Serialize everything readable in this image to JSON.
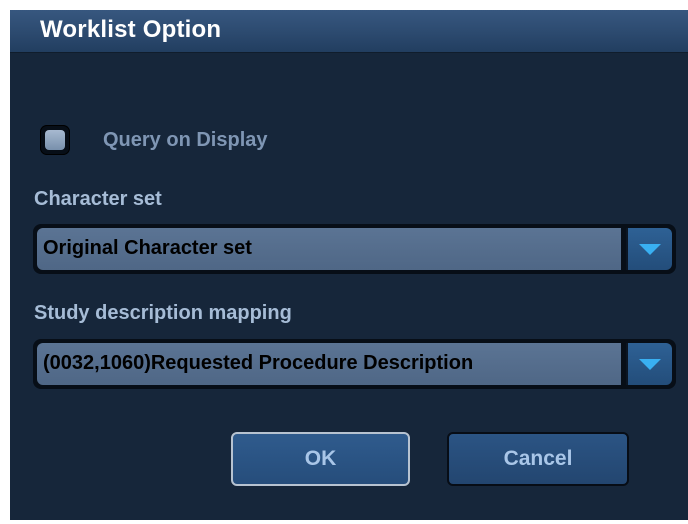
{
  "dialog": {
    "title": "Worklist Option",
    "query_on_display": {
      "label": "Query on Display",
      "checked": false
    },
    "character_set": {
      "label": "Character set",
      "value": "Original Character set"
    },
    "study_description_mapping": {
      "label": "Study description mapping",
      "value": "(0032,1060)Requested Procedure Description"
    },
    "buttons": {
      "ok": "OK",
      "cancel": "Cancel"
    },
    "icons": {
      "dropdown": "chevron-down-icon"
    },
    "colors": {
      "background": "#16263a",
      "titlebar": "#2c4a6f",
      "label_text": "#a6bcd6",
      "dropdown_arrow": "#39b0f2",
      "button_text": "#a9c6e8"
    }
  }
}
